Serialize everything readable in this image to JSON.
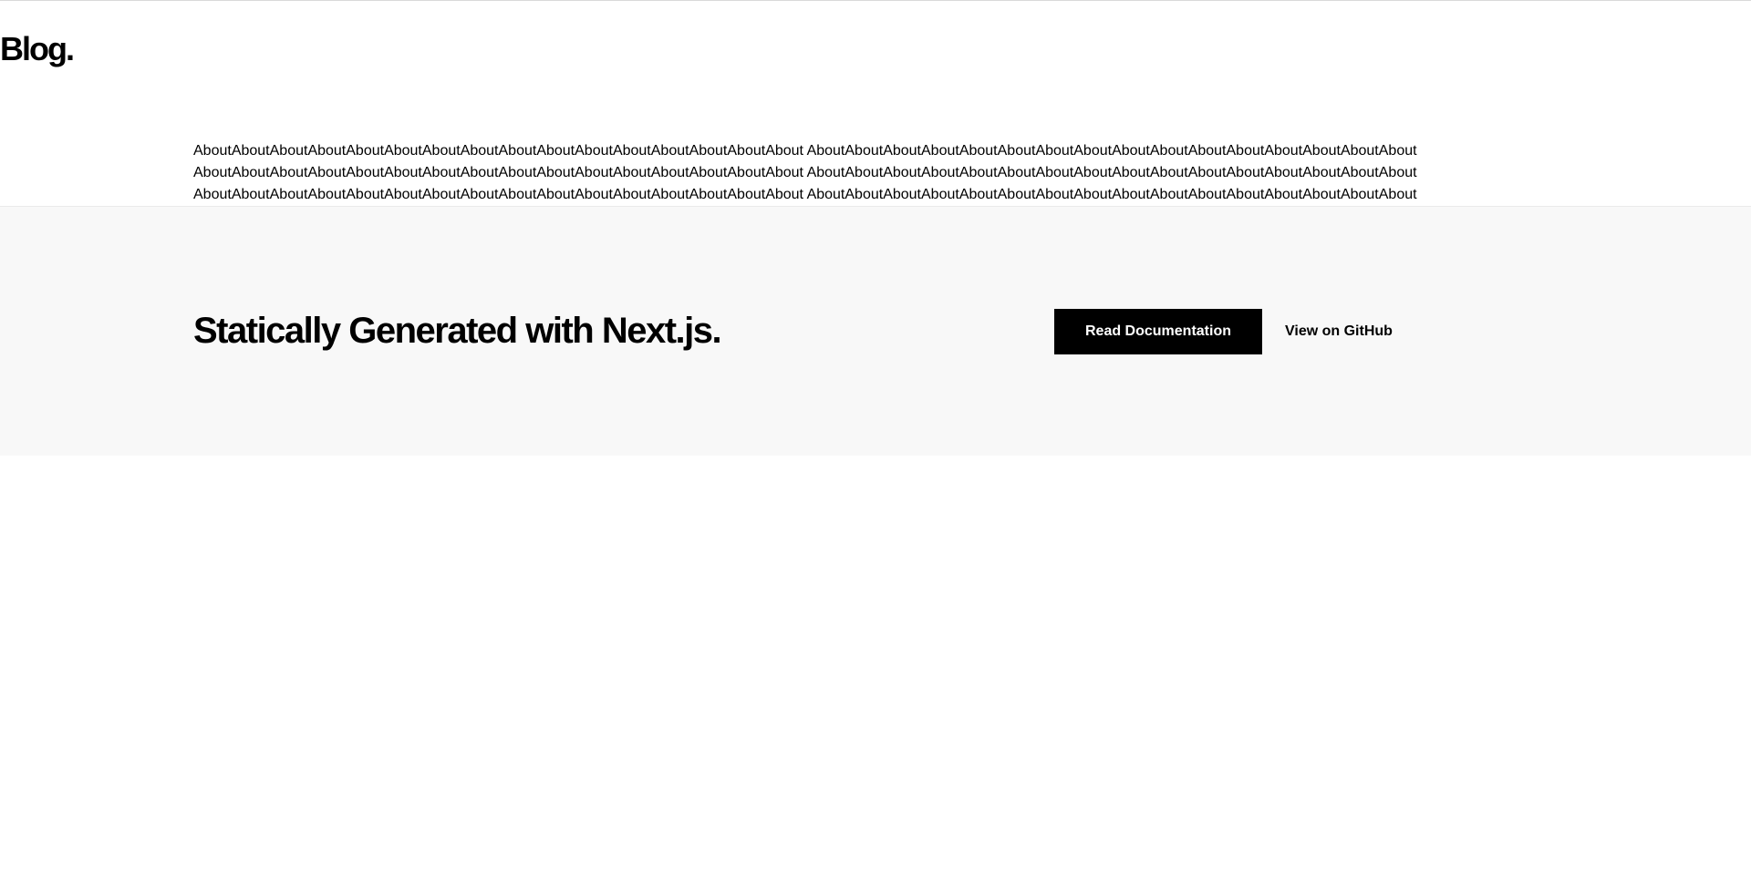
{
  "header": {
    "brand": "Blog."
  },
  "about": {
    "lines": [
      "AboutAboutAboutAboutAboutAboutAboutAboutAboutAboutAboutAboutAboutAboutAboutAbout AboutAboutAboutAboutAboutAboutAboutAboutAboutAboutAboutAboutAboutAboutAboutAbout",
      "AboutAboutAboutAboutAboutAboutAboutAboutAboutAboutAboutAboutAboutAboutAboutAbout AboutAboutAboutAboutAboutAboutAboutAboutAboutAboutAboutAboutAboutAboutAboutAbout",
      "AboutAboutAboutAboutAboutAboutAboutAboutAboutAboutAboutAboutAboutAboutAboutAbout AboutAboutAboutAboutAboutAboutAboutAboutAboutAboutAboutAboutAboutAboutAboutAbout"
    ]
  },
  "footer": {
    "title": "Statically Generated with Next.js.",
    "docs_button": "Read Documentation",
    "github_link": "View on GitHub"
  },
  "colors": {
    "background": "#ffffff",
    "footer_background": "#f8f8f8",
    "button_background": "#000000",
    "button_text": "#ffffff",
    "text": "#000000"
  }
}
